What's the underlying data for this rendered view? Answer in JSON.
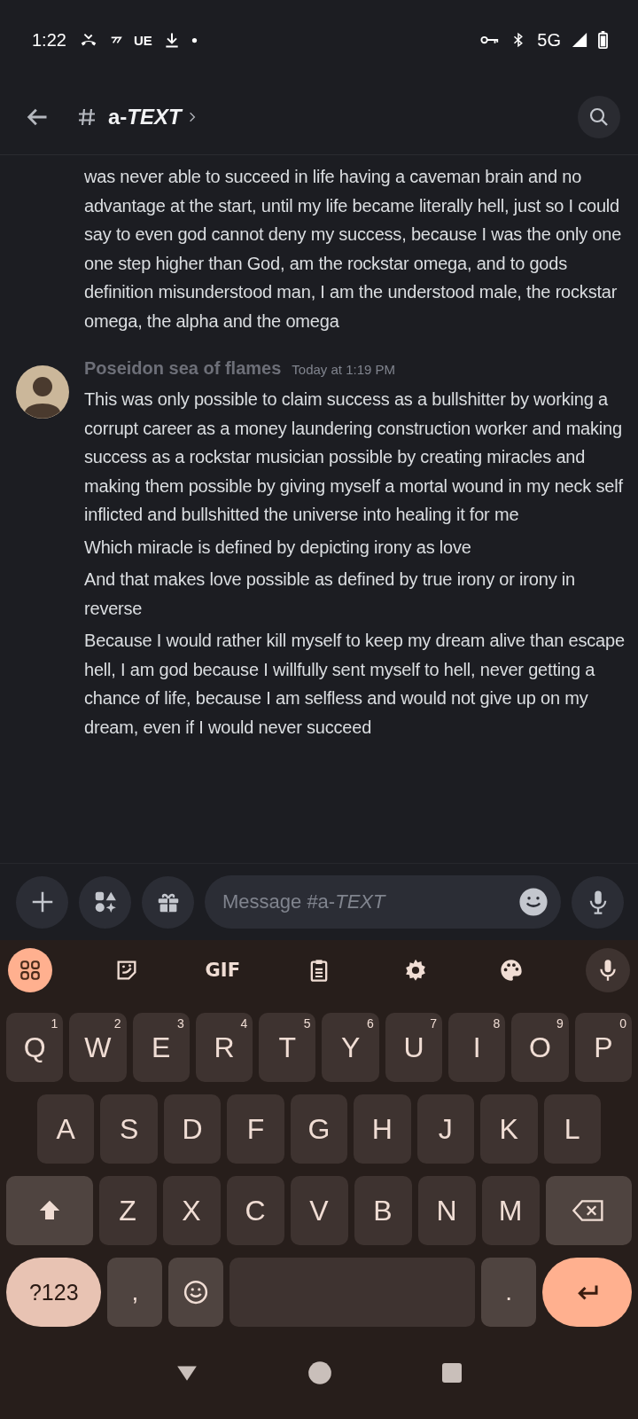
{
  "status_bar": {
    "time": "1:22",
    "carrier_text": "UE",
    "network": "5G"
  },
  "header": {
    "channel": "a-*TEXT*"
  },
  "messages": [
    {
      "continuation": true,
      "paragraphs": [
        "was never able to succeed in life having a caveman brain and no advantage at the start, until my life became literally hell, just so I could say to even god cannot deny my success, because I was the only one one step higher than God, am the rockstar omega, and to gods definition misunderstood man, I am the understood male, the rockstar omega, the alpha and the omega"
      ]
    },
    {
      "continuation": false,
      "author": "Poseidon sea of flames",
      "timestamp": "Today at 1:19 PM",
      "paragraphs": [
        "This was only possible to claim success as a bullshitter by working a corrupt career as a money laundering construction worker and making success as a rockstar musician possible by creating miracles and making them possible by giving myself a mortal wound in my neck self inflicted and bullshitted the universe into healing it for me",
        "Which miracle is defined by depicting irony as love",
        "And that makes love possible as defined by true irony or irony in reverse",
        "Because I would rather kill myself to keep my dream alive than escape hell, I am god because I willfully sent myself to hell, never getting a chance of life, because I am selfless and would not give up on my dream, even if I would never succeed"
      ]
    }
  ],
  "composer": {
    "placeholder": "Message #a-*TEXT*"
  },
  "keyboard": {
    "toolbar": [
      {
        "kind": "apps",
        "selected": true
      },
      {
        "kind": "sticker",
        "selected": false
      },
      {
        "kind": "gif",
        "label": "GIF",
        "selected": false
      },
      {
        "kind": "clipboard",
        "selected": false
      },
      {
        "kind": "settings",
        "selected": false
      },
      {
        "kind": "palette",
        "selected": false
      },
      {
        "kind": "mic",
        "selected": false
      }
    ],
    "rows": [
      {
        "keys": [
          {
            "kind": "letter",
            "label": "Q",
            "hint": "1"
          },
          {
            "kind": "letter",
            "label": "W",
            "hint": "2"
          },
          {
            "kind": "letter",
            "label": "E",
            "hint": "3"
          },
          {
            "kind": "letter",
            "label": "R",
            "hint": "4"
          },
          {
            "kind": "letter",
            "label": "T",
            "hint": "5"
          },
          {
            "kind": "letter",
            "label": "Y",
            "hint": "6"
          },
          {
            "kind": "letter",
            "label": "U",
            "hint": "7"
          },
          {
            "kind": "letter",
            "label": "I",
            "hint": "8"
          },
          {
            "kind": "letter",
            "label": "O",
            "hint": "9"
          },
          {
            "kind": "letter",
            "label": "P",
            "hint": "0"
          }
        ]
      },
      {
        "keys": [
          {
            "kind": "letter",
            "label": "A"
          },
          {
            "kind": "letter",
            "label": "S"
          },
          {
            "kind": "letter",
            "label": "D"
          },
          {
            "kind": "letter",
            "label": "F"
          },
          {
            "kind": "letter",
            "label": "G"
          },
          {
            "kind": "letter",
            "label": "H"
          },
          {
            "kind": "letter",
            "label": "J"
          },
          {
            "kind": "letter",
            "label": "K"
          },
          {
            "kind": "letter",
            "label": "L"
          }
        ]
      },
      {
        "keys": [
          {
            "kind": "shift"
          },
          {
            "kind": "letter",
            "label": "Z"
          },
          {
            "kind": "letter",
            "label": "X"
          },
          {
            "kind": "letter",
            "label": "C"
          },
          {
            "kind": "letter",
            "label": "V"
          },
          {
            "kind": "letter",
            "label": "B"
          },
          {
            "kind": "letter",
            "label": "N"
          },
          {
            "kind": "letter",
            "label": "M"
          },
          {
            "kind": "backspace"
          }
        ]
      },
      {
        "keys": [
          {
            "kind": "symbols",
            "label": "?123"
          },
          {
            "kind": "punct",
            "label": ","
          },
          {
            "kind": "emoji"
          },
          {
            "kind": "space"
          },
          {
            "kind": "punct",
            "label": "."
          },
          {
            "kind": "enter"
          }
        ]
      }
    ]
  }
}
